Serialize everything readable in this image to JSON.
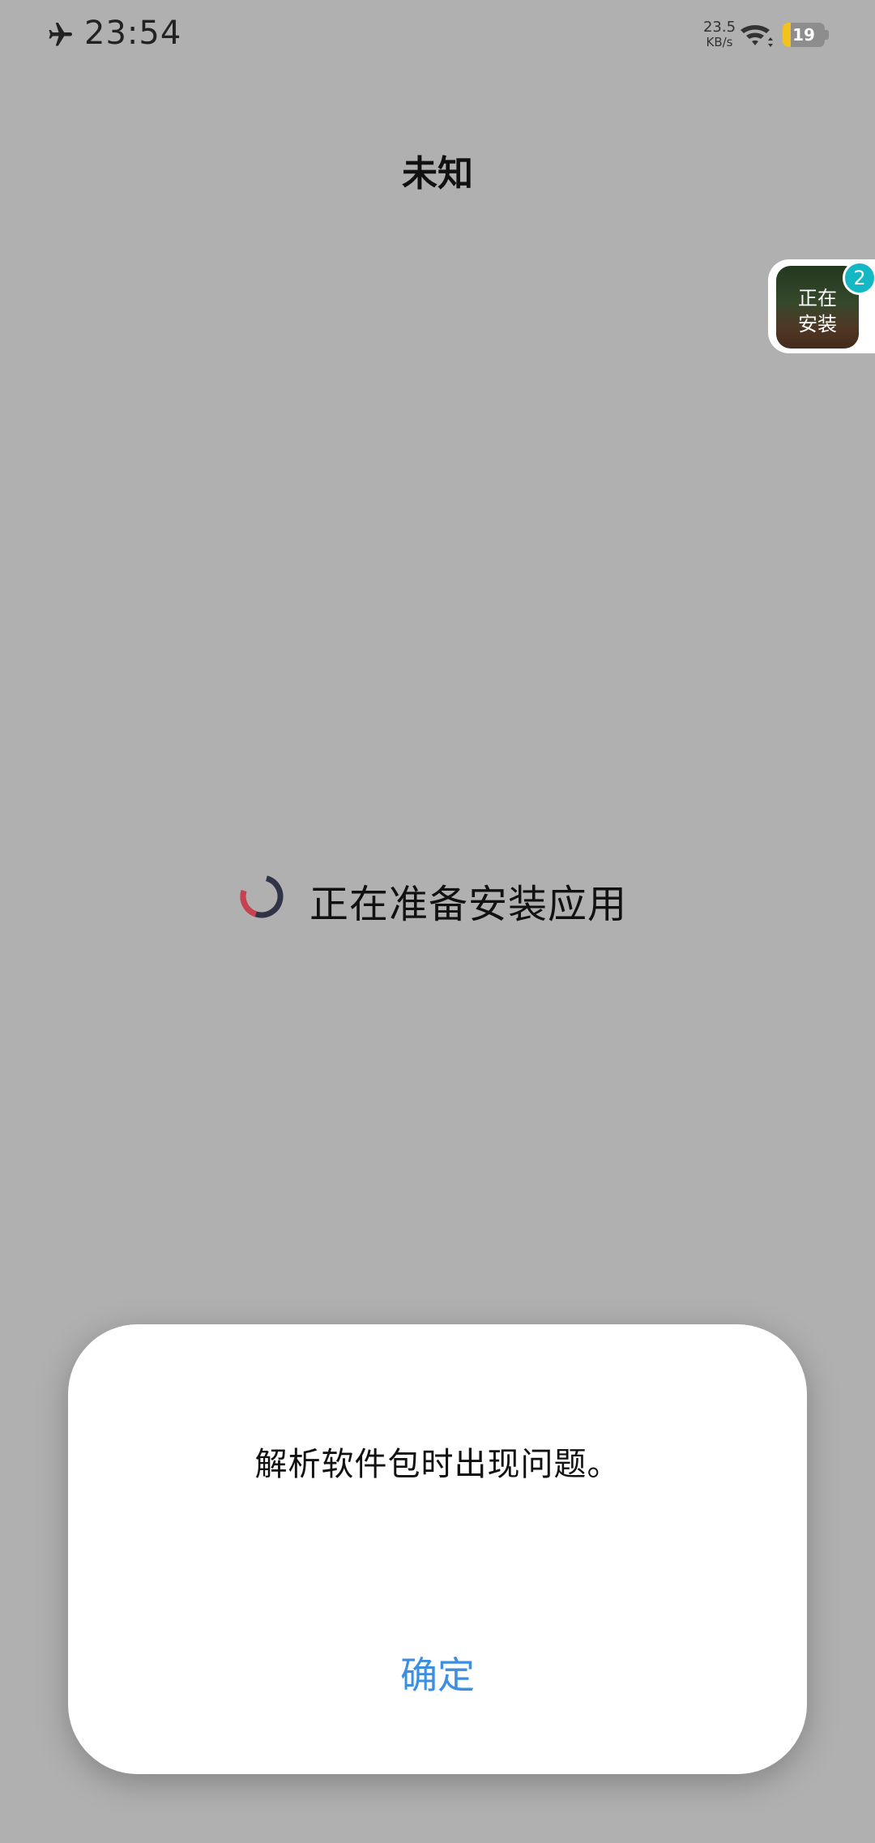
{
  "status_bar": {
    "time": "23:54",
    "net_speed_value": "23.5",
    "net_speed_unit": "KB/s",
    "battery_level": "19",
    "battery_fraction": 0.19,
    "icons": [
      "airplane-icon",
      "wifi-icon",
      "battery-icon"
    ]
  },
  "page": {
    "title": "未知",
    "progress_text": "正在准备安装应用"
  },
  "float_install": {
    "label_line1": "正在",
    "label_line2": "安装",
    "badge_count": "2",
    "badge_color": "#13b8c4"
  },
  "dialog": {
    "message": "解析软件包时出现问题。",
    "ok_label": "确定",
    "accent_color": "#3c8ee0"
  },
  "colors": {
    "background": "#b0b0b0",
    "spinner_dark": "#2f3446",
    "spinner_red": "#c9404e"
  }
}
